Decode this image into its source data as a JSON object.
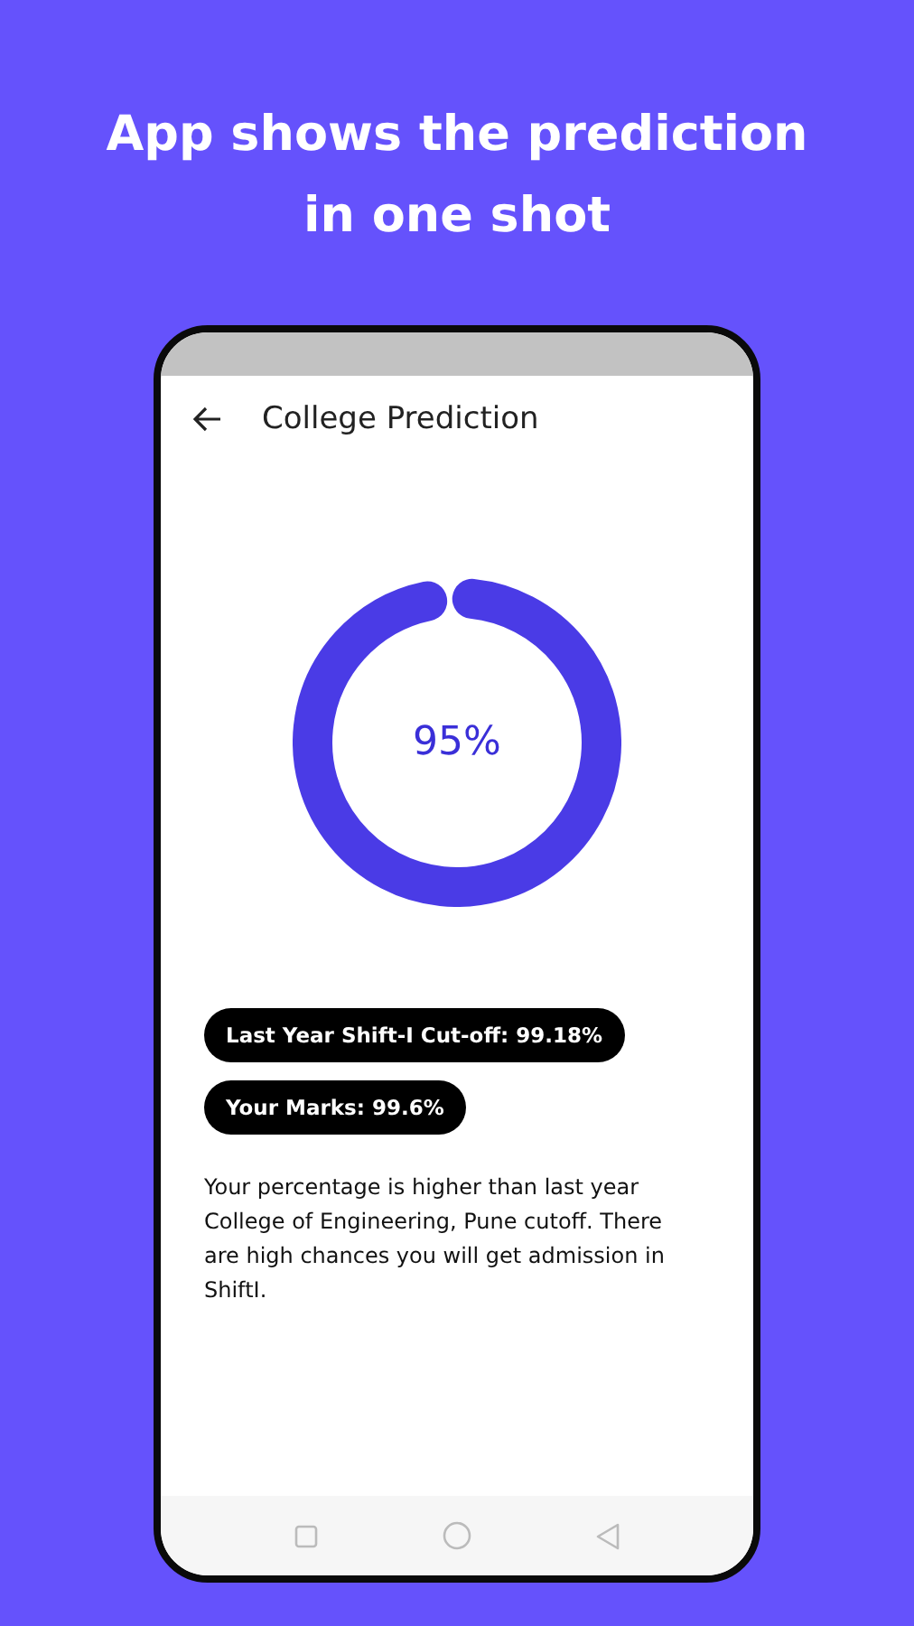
{
  "headline": "App shows the prediction in one shot",
  "app_bar": {
    "title": "College Prediction"
  },
  "prediction": {
    "level": 0.95,
    "reading": "95%"
  },
  "chips": [
    "Last Year Shift-I Cut-off: 99.18%",
    "Your Marks: 99.6%"
  ],
  "message": "Your percentage is higher than last year College of Engineering, Pune cutoff. There are high chances you will get admission in ShiftI."
}
